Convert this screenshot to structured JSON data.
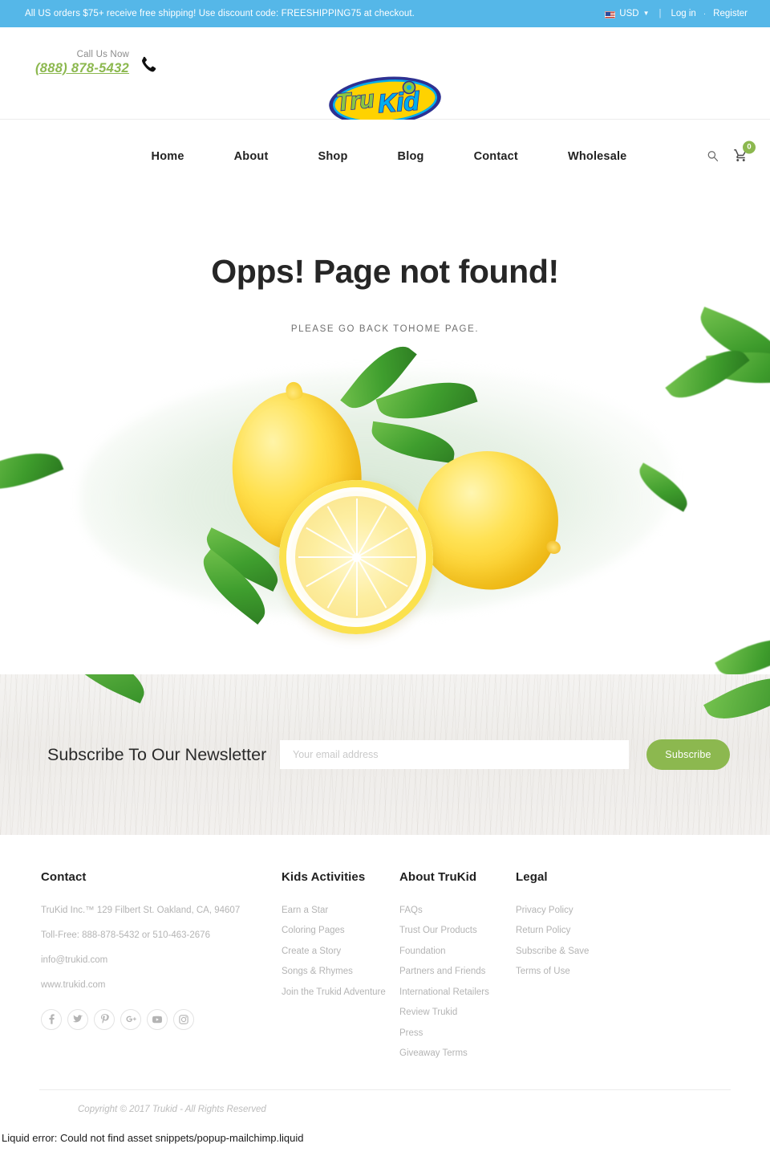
{
  "topbar": {
    "promo_message": "All US orders $75+ receive free shipping! Use discount code: FREESHIPPING75 at checkout.",
    "currency": "USD",
    "flag_icon": "us-flag-icon",
    "chevron_icon": "chevron-down-icon",
    "separator": "|",
    "dot_separator": "·",
    "login_label": "Log in",
    "register_label": "Register",
    "bg_color": "#55b7e8"
  },
  "header": {
    "call_label": "Call Us Now",
    "phone_number": "(888) 878-5432",
    "phone_icon": "phone-icon",
    "logo_text_1": "Tru",
    "logo_text_2": "Kid",
    "logo_alt": "TruKid logo",
    "phone_color": "#8cb84f"
  },
  "nav": {
    "items": [
      {
        "label": "Home"
      },
      {
        "label": "About"
      },
      {
        "label": "Shop"
      },
      {
        "label": "Blog"
      },
      {
        "label": "Contact"
      },
      {
        "label": "Wholesale"
      }
    ],
    "search_icon": "search-icon",
    "cart_icon": "shopping-cart-icon",
    "cart_count": "0",
    "cart_badge_color": "#8cb84f"
  },
  "main": {
    "error_title": "Opps! Page not found!",
    "error_sub_prefix": "PLEASE GO BACK TO",
    "error_sub_link": "HOME PAGE",
    "error_sub_suffix": ".",
    "hero_art_alt": "lemons-illustration"
  },
  "newsletter": {
    "title": "Subscribe To Our Newsletter",
    "email_placeholder": "Your email address",
    "email_value": "",
    "button_label": "Subscribe",
    "button_color": "#8cb84f"
  },
  "footer": {
    "columns": [
      {
        "heading": "Contact",
        "lines": [
          "TruKid Inc.™ 129 Filbert St. Oakland, CA, 94607",
          "Toll-Free: 888-878-5432 or 510-463-2676",
          "info@trukid.com",
          "www.trukid.com"
        ]
      },
      {
        "heading": "Kids Activities",
        "links": [
          "Earn a Star",
          "Coloring Pages",
          "Create a Story",
          "Songs & Rhymes",
          "Join the Trukid Adventure"
        ]
      },
      {
        "heading": "About TruKid",
        "links": [
          "FAQs",
          "Trust Our Products",
          "Foundation",
          "Partners and Friends",
          "International Retailers",
          "Review Trukid",
          "Press",
          "Giveaway Terms"
        ]
      },
      {
        "heading": "Legal",
        "links": [
          "Privacy Policy",
          "Return Policy",
          "Subscribe & Save",
          "Terms of Use"
        ]
      }
    ],
    "social": [
      {
        "name": "facebook-icon",
        "glyph": "f"
      },
      {
        "name": "twitter-icon",
        "glyph": "ᴛ"
      },
      {
        "name": "pinterest-icon",
        "glyph": "Ⓟ"
      },
      {
        "name": "google-plus-icon",
        "glyph": "8⁺"
      },
      {
        "name": "youtube-icon",
        "glyph": "▶"
      },
      {
        "name": "instagram-icon",
        "glyph": "▣"
      }
    ],
    "copyright": "Copyright © 2017 Trukid - All Rights Reserved"
  },
  "page_error": {
    "message": "Liquid error: Could not find asset snippets/popup-mailchimp.liquid"
  }
}
